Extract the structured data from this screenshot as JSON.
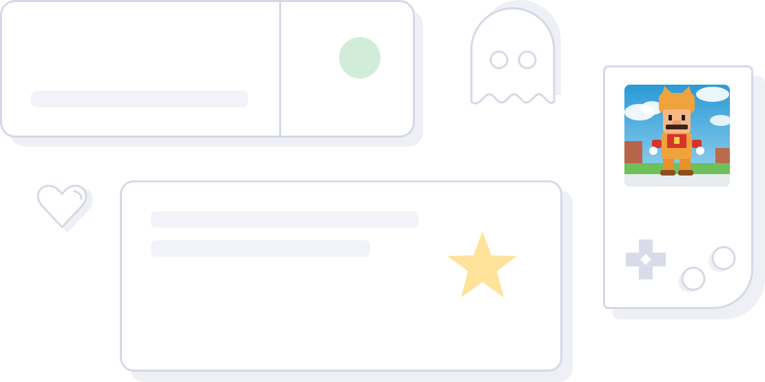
{
  "illustration": {
    "elements": [
      {
        "kind": "card",
        "name": "top-card"
      },
      {
        "kind": "icon",
        "name": "green-dot-icon"
      },
      {
        "kind": "icon",
        "name": "ghost-icon"
      },
      {
        "kind": "icon",
        "name": "heart-icon"
      },
      {
        "kind": "card",
        "name": "bottom-card"
      },
      {
        "kind": "icon",
        "name": "star-icon"
      },
      {
        "kind": "device",
        "name": "handheld-console"
      },
      {
        "kind": "image",
        "name": "mario-figure-photo"
      },
      {
        "kind": "icon",
        "name": "dpad-icon"
      },
      {
        "kind": "icon",
        "name": "a-button-icon"
      },
      {
        "kind": "icon",
        "name": "b-button-icon"
      }
    ]
  },
  "colors": {
    "outline": "#d5d9e6",
    "shadow": "#eff0f6",
    "placeholder": "#f2f3f8",
    "green_dot": "#d1ecd8",
    "star": "#ffe29c",
    "dpad": "#d9dce8",
    "sky": "#5bb7e6",
    "mario_orange": "#f0a23c",
    "mario_red": "#d9322b"
  }
}
